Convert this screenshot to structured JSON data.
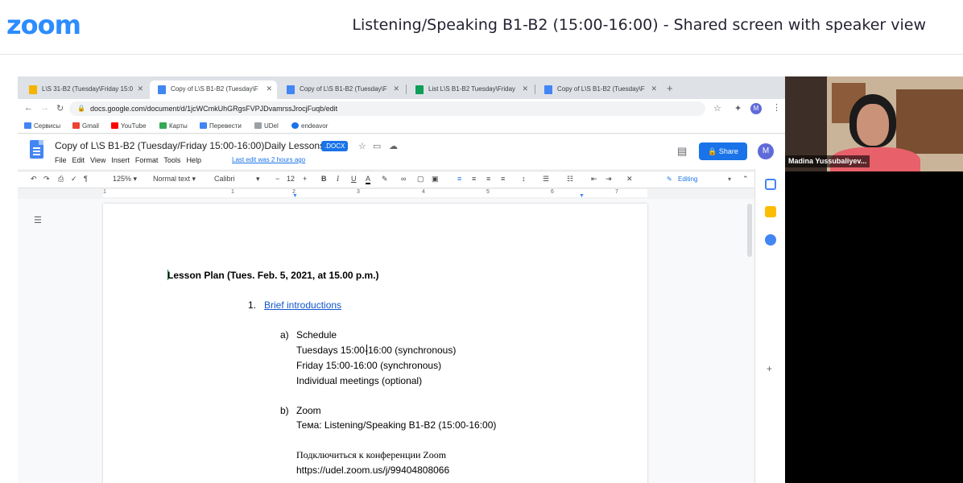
{
  "zoom": {
    "logo": "zoom",
    "title": "Listening/Speaking B1-B2 (15:00-16:00) - Shared screen with speaker view"
  },
  "browser": {
    "tabs": [
      {
        "label": "L\\S 31-B2 (Tuesday\\Friday 15:0",
        "icon": "drive-icon",
        "color": "#f4b400"
      },
      {
        "label": "Copy of L\\S B1-B2 (Tuesday\\F",
        "icon": "docs-icon",
        "color": "#4285f4"
      },
      {
        "label": "Copy of L\\S B1-B2 (Tuesday\\F",
        "icon": "docs-icon",
        "color": "#4285f4"
      },
      {
        "label": "List L\\S B1-B2 Tuesday\\Friday",
        "icon": "sheets-icon",
        "color": "#0f9d58"
      },
      {
        "label": "Copy of L\\S B1-B2 (Tuesday\\F",
        "icon": "docs-icon",
        "color": "#4285f4"
      }
    ],
    "new_tab": "+",
    "url": "docs.google.com/document/d/1jcWCmkUhGRgsFVPJDvamrssJrocjFuqb/edit",
    "profile_initial": "M",
    "bookmarks": [
      {
        "label": "Сервисы",
        "color": "#4285f4"
      },
      {
        "label": "Gmail",
        "color": "#ea4335"
      },
      {
        "label": "YouTube",
        "color": "#ff0000"
      },
      {
        "label": "Карты",
        "color": "#34a853"
      },
      {
        "label": "Перевести",
        "color": "#4285f4"
      },
      {
        "label": "UDel",
        "color": "#9aa0a6"
      },
      {
        "label": "endeavor",
        "color": "#1a73e8"
      }
    ]
  },
  "docs": {
    "title": "Copy of L\\S B1-B2 (Tuesday/Friday 15:00-16:00)Daily Lessons",
    "badge": ".DOCX",
    "menus": [
      "File",
      "Edit",
      "View",
      "Insert",
      "Format",
      "Tools",
      "Help"
    ],
    "last_edit": "Last edit was 2 hours ago",
    "share_label": "Share",
    "avatar_initial": "M",
    "toolbar": {
      "zoom": "125%",
      "style": "Normal text",
      "font": "Calibri",
      "size": "12",
      "mode": "Editing"
    },
    "ruler_numbers": [
      "1",
      "1",
      "2",
      "3",
      "4",
      "5",
      "6",
      "7"
    ],
    "content": {
      "heading": "Lesson Plan (Tues. Feb. 5, 2021, at 15.00 p.m.)",
      "item1_number": "1.",
      "item1_link": "Brief introductions",
      "sub_a_marker": "a)",
      "sub_a_title": "Schedule",
      "sub_a_line1": "Tuesdays 15:00-16:00 (synchronous)",
      "sub_a_line2": "Friday 15:00-16:00 (synchronous)",
      "sub_a_line3": "Individual meetings (optional)",
      "sub_b_marker": "b)",
      "sub_b_title": "Zoom",
      "sub_b_line1": "Тема: Listening/Speaking B1-B2 (15:00-16:00)",
      "sub_b_line2": "Подключиться к конференции Zoom",
      "sub_b_line3": "https://udel.zoom.us/j/99404808066"
    }
  },
  "participant": {
    "name": "Madina Yussubaliyev..."
  },
  "colors": {
    "zoom_blue": "#2D8CFF",
    "docs_blue": "#1a73e8",
    "link_blue": "#1155cc"
  }
}
